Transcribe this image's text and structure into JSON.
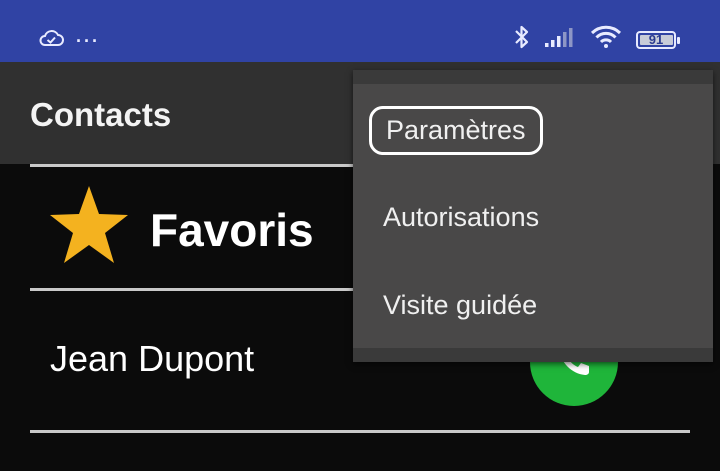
{
  "status_bar": {
    "left_icons": [
      "cloud-check-icon",
      "more-dots-icon"
    ],
    "dots": "···",
    "right_icons": [
      "bluetooth-icon",
      "signal-icon",
      "wifi-icon",
      "battery-icon"
    ],
    "battery_level": "91",
    "color": "#3043a4"
  },
  "app_bar": {
    "title": "Contacts"
  },
  "favorites": {
    "icon": "star-icon",
    "label": "Favoris",
    "star_color": "#f4b21f"
  },
  "contacts": [
    {
      "name": "Jean Dupont",
      "action_icon": "phone-icon",
      "action_color": "#1fb53a"
    }
  ],
  "overflow_menu": {
    "items": [
      {
        "label": "Paramètres",
        "highlighted": true
      },
      {
        "label": "Autorisations",
        "highlighted": false
      },
      {
        "label": "Visite guidée",
        "highlighted": false
      }
    ]
  }
}
